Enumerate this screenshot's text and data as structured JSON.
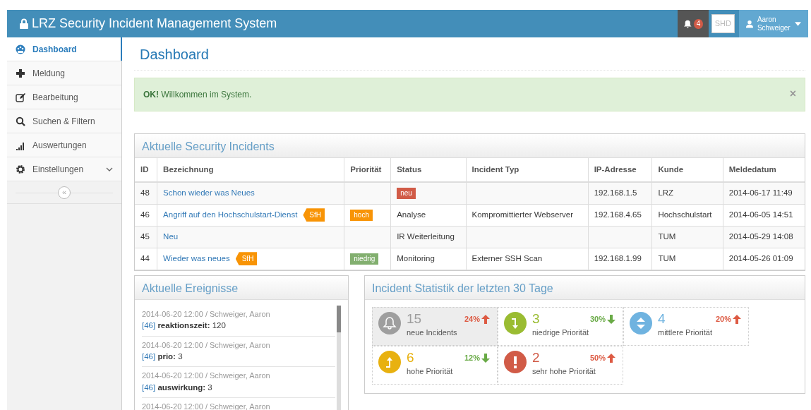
{
  "navbar": {
    "title": "LRZ Security Incident Management System",
    "notifications": "4",
    "shortcut": "SHD",
    "user": "Aaron Schweiger"
  },
  "sidebar": {
    "items": [
      {
        "label": "Dashboard",
        "selected": true,
        "expandable": false
      },
      {
        "label": "Meldung",
        "selected": false,
        "expandable": false
      },
      {
        "label": "Bearbeitung",
        "selected": false,
        "expandable": false
      },
      {
        "label": "Suchen & Filtern",
        "selected": false,
        "expandable": false
      },
      {
        "label": "Auswertungen",
        "selected": false,
        "expandable": false
      },
      {
        "label": "Einstellungen",
        "selected": false,
        "expandable": true
      }
    ],
    "collapse": "«"
  },
  "page_title": "Dashboard",
  "alert": {
    "text": "**OK!** Willkommen im System.",
    "close": "×"
  },
  "incidents": {
    "title": "Aktuelle Security Incidents",
    "columns": [
      "ID",
      "Bezeichnung",
      "Priorität",
      "Status",
      "Incident Typ",
      "IP-Adresse",
      "Kunde",
      "Meldedatum"
    ],
    "rows": [
      {
        "id": "48",
        "name": "Schon wieder was Neues",
        "status": {
          "label": "neu",
          "kind": "badge"
        },
        "customer": "LRZ",
        "ip": "192.168.1.5",
        "date": "2014-06-17 11:49"
      },
      {
        "id": "46",
        "name": "Angriff auf den Hochschulstart-Dienst",
        "tag": "SfH",
        "priority": {
          "label": "hoch",
          "kind": "high"
        },
        "status": {
          "label": "Analyse",
          "kind": "text"
        },
        "type": "Kompromittierter Webserver",
        "ip": "192.168.4.65",
        "customer": "Hochschulstart",
        "date": "2014-06-05 14:51"
      },
      {
        "id": "45",
        "name": "Neu",
        "status": {
          "label": "IR Weiterleitung",
          "kind": "text"
        },
        "customer": "TUM",
        "date": "2014-05-29 14:08"
      },
      {
        "id": "44",
        "name": "Wieder was neues",
        "tag": "SfH",
        "priority": {
          "label": "niedrig",
          "kind": "low"
        },
        "status": {
          "label": "Monitoring",
          "kind": "text"
        },
        "type": "Externer SSH Scan",
        "ip": "192.168.1.99",
        "customer": "TUM",
        "date": "2014-05-26 01:09"
      }
    ]
  },
  "events": {
    "title": "Aktuelle Ereignisse",
    "items": [
      {
        "meta": "2014-06-20 12:00 / Schweiger, Aaron",
        "ref": "[46]",
        "text": "**reaktionszeit:** 120"
      },
      {
        "meta": "2014-06-20 12:00 / Schweiger, Aaron",
        "ref": "[46]",
        "text": "**prio:** 3"
      },
      {
        "meta": "2014-06-20 12:00 / Schweiger, Aaron",
        "ref": "[46]",
        "text": "**auswirkung:** 3"
      },
      {
        "meta": "2014-06-20 12:00 / Schweiger, Aaron"
      }
    ]
  },
  "stats": {
    "title": "Incident Statistik der letzten 30 Tage",
    "tiles": [
      {
        "kind": "new",
        "value": "15",
        "label": "neue Incidents",
        "change": "24%",
        "rising": true,
        "selected": true
      },
      {
        "kind": "low",
        "value": "3",
        "label": "niedrige Priorität",
        "change": "30%",
        "rising": false,
        "selected": false
      },
      {
        "kind": "medium",
        "value": "4",
        "label": "mittlere Priorität",
        "change": "20%",
        "rising": true,
        "selected": false
      },
      {
        "kind": "high",
        "value": "6",
        "label": "hohe Priorität",
        "change": "12%",
        "rising": false,
        "selected": false
      },
      {
        "kind": "critical",
        "value": "2",
        "label": "sehr hohe Priorität",
        "change": "50%",
        "rising": true,
        "selected": false
      }
    ]
  }
}
